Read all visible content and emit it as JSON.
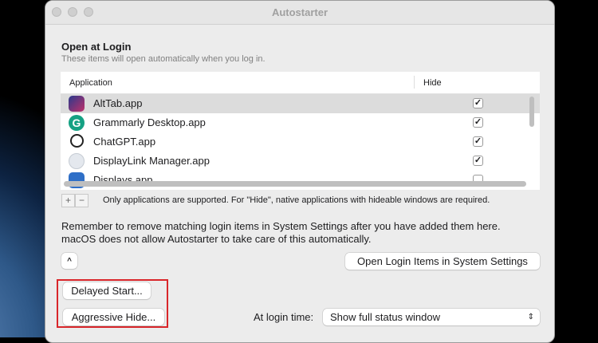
{
  "window": {
    "title": "Autostarter"
  },
  "section": {
    "title": "Open at Login",
    "subtitle": "These items will open automatically when you log in."
  },
  "table": {
    "columns": [
      "Application",
      "Hide"
    ],
    "rows": [
      {
        "name": "AltTab.app",
        "hide": true,
        "icon": "alttab-icon",
        "selected": true
      },
      {
        "name": "Grammarly Desktop.app",
        "hide": true,
        "icon": "grammarly-icon"
      },
      {
        "name": "ChatGPT.app",
        "hide": true,
        "icon": "chatgpt-icon"
      },
      {
        "name": "DisplayLink Manager.app",
        "hide": true,
        "icon": "displaylink-icon"
      },
      {
        "name": "Displays.app",
        "hide": false,
        "icon": "app-icon"
      }
    ]
  },
  "controls": {
    "add": "+",
    "remove": "−",
    "notice": "Only applications are supported. For \"Hide\", native applications with hideable windows are required."
  },
  "info": {
    "line1": "Remember to remove matching login items in System Settings after you have added them here.",
    "line2": "macOS does not allow Autostarter to take care of this automatically."
  },
  "buttons": {
    "collapse": "^",
    "open_settings": "Open Login Items in System Settings",
    "delayed_start": "Delayed Start...",
    "aggressive_hide": "Aggressive Hide..."
  },
  "login_time": {
    "label": "At login time:",
    "value": "Show full status window"
  },
  "colors": {
    "highlight": "#d9262a"
  }
}
